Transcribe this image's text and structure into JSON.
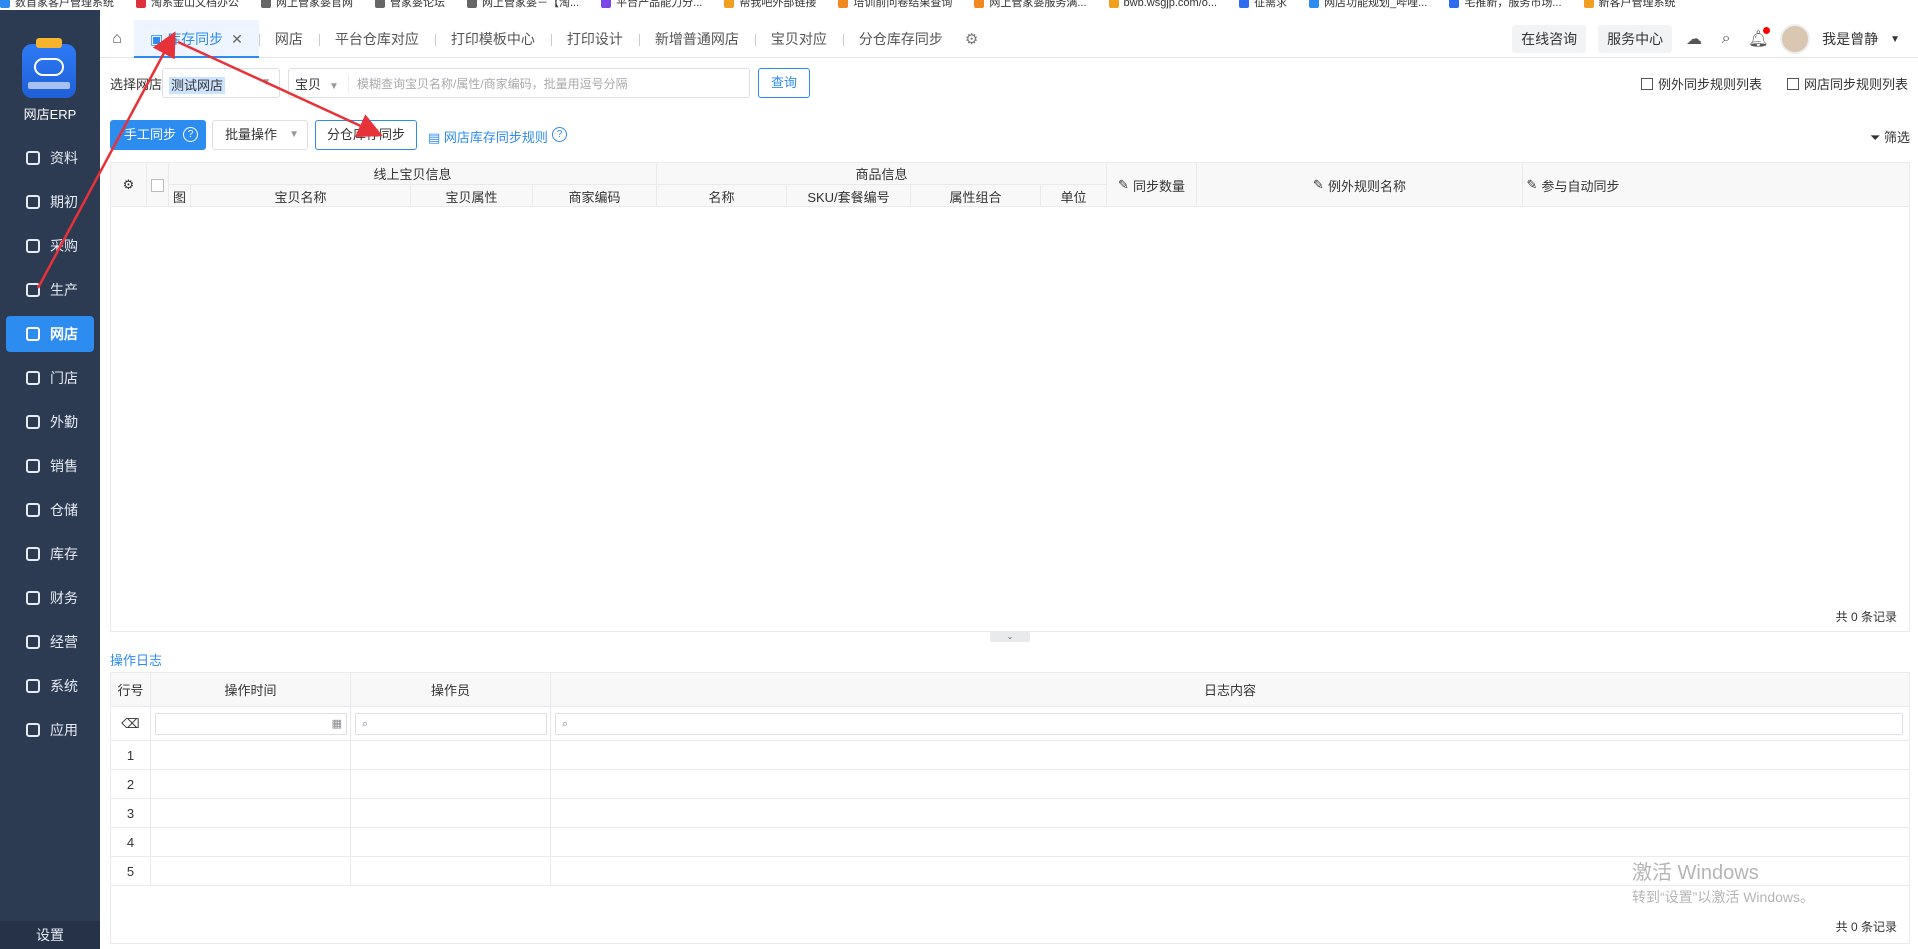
{
  "bookmarks": [
    {
      "label": "数首家客户管理系统",
      "color": "#2d8cf0"
    },
    {
      "label": "淘系金山文档办公",
      "color": "#e0323d"
    },
    {
      "label": "网上管家婆官网",
      "color": "#666666"
    },
    {
      "label": "管家婆论坛",
      "color": "#666666"
    },
    {
      "label": "网上管家婆－【淘...",
      "color": "#666666"
    },
    {
      "label": "平台产品能力分...",
      "color": "#7b48e8"
    },
    {
      "label": "帮我吧外部链接",
      "color": "#f0a020"
    },
    {
      "label": "培训前问卷结果查询",
      "color": "#f08a20"
    },
    {
      "label": "网上管家婆服务满...",
      "color": "#f08a20"
    },
    {
      "label": "bwb.wsgjp.com/o...",
      "color": "#f0a020"
    },
    {
      "label": "征需求",
      "color": "#2d6cf0"
    },
    {
      "label": "网店功能规划_哔哩...",
      "color": "#2d8cf0"
    },
    {
      "label": "宅推新，服务市场...",
      "color": "#2d6cf0"
    },
    {
      "label": "新客户管理系统",
      "color": "#f0a020"
    }
  ],
  "sidebar": {
    "app_name": "网店ERP",
    "items": [
      {
        "label": "资料"
      },
      {
        "label": "期初"
      },
      {
        "label": "采购"
      },
      {
        "label": "生产"
      },
      {
        "label": "网店"
      },
      {
        "label": "门店"
      },
      {
        "label": "外勤"
      },
      {
        "label": "销售"
      },
      {
        "label": "仓储"
      },
      {
        "label": "库存"
      },
      {
        "label": "财务"
      },
      {
        "label": "经营"
      },
      {
        "label": "系统"
      },
      {
        "label": "应用"
      }
    ],
    "active": "网店",
    "settings_label": "设置"
  },
  "tabs": [
    "库存同步",
    "网店",
    "平台仓库对应",
    "打印模板中心",
    "打印设计",
    "新增普通网店",
    "宝贝对应",
    "分仓库存同步"
  ],
  "header": {
    "consult": "在线咨询",
    "service": "服务中心",
    "username": "我是曾静"
  },
  "filter": {
    "shop_label": "选择网店",
    "shop_value": "测试网店",
    "search_type": "宝贝",
    "search_placeholder": "模糊查询宝贝名称/属性/商家编码，批量用逗号分隔",
    "query_btn": "查询",
    "exception_rules": "例外同步规则列表",
    "shop_rules": "网店同步规则列表"
  },
  "actions": {
    "manual_sync": "手工同步",
    "batch": "批量操作",
    "split_sync": "分仓库存同步",
    "rule_link": "网店库存同步规则",
    "filter": "筛选"
  },
  "grid": {
    "group_online": "线上宝贝信息",
    "group_goods": "商品信息",
    "col_img": "图",
    "col_name": "宝贝名称",
    "col_attr": "宝贝属性",
    "col_code": "商家编码",
    "col_gname": "名称",
    "col_sku": "SKU/套餐编号",
    "col_combo": "属性组合",
    "col_unit": "单位",
    "col_qty": "同步数量",
    "col_rule": "例外规则名称",
    "col_auto": "参与自动同步",
    "footer": "共 0 条记录"
  },
  "oplog": {
    "title": "操作日志",
    "col_no": "行号",
    "col_time": "操作时间",
    "col_user": "操作员",
    "col_content": "日志内容",
    "rows": [
      "1",
      "2",
      "3",
      "4",
      "5"
    ],
    "footer": "共 0 条记录"
  },
  "watermark": {
    "line1": "激活 Windows",
    "line2": "转到“设置”以激活 Windows。"
  }
}
